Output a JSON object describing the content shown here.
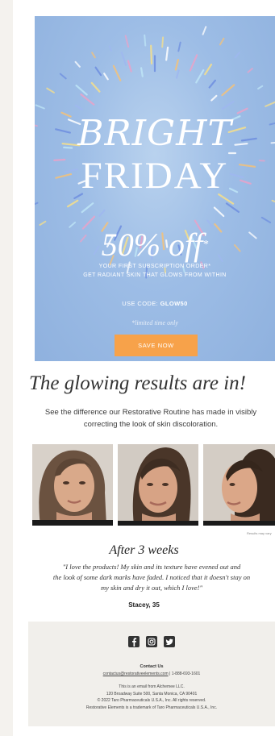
{
  "hero": {
    "headline_1": "BRIGHT",
    "headline_2": "FRIDAY",
    "discount": "50% off",
    "discount_note": "*",
    "subline_1": "YOUR FIRST SUBSCRIPTION ORDER*",
    "subline_2": "GET RADIANT SKIN THAT GLOWS FROM WITHIN",
    "code_label": "USE CODE:",
    "code": "GLOW50",
    "limited": "*limited time only",
    "cta_label": "SAVE NOW",
    "colors": {
      "background": "#9dbde6",
      "cta": "#f7a24a"
    }
  },
  "results": {
    "headline": "The glowing results are in!",
    "description_1": "See the difference our Restorative Routine has made in visibly",
    "description_2": "correcting the look of skin discoloration.",
    "photos": [
      {
        "alt": "face-front"
      },
      {
        "alt": "face-angle"
      },
      {
        "alt": "face-profile"
      }
    ],
    "disclaimer": "Results may vary",
    "after_title": "After 3 weeks",
    "quote_1": "\"I love the products! My skin and its texture have evened out and",
    "quote_2": "the look of some dark marks have faded. I noticed that it doesn't stay on",
    "quote_3": "my skin and dry it out, which I love!\"",
    "author": "Stacey, 35"
  },
  "footer": {
    "social_icons": [
      "facebook-icon",
      "instagram-icon",
      "twitter-icon"
    ],
    "contact_title": "Contact Us",
    "email": "contactus@restorativeelements.com",
    "separator": "|",
    "phone": "1-888-693-1601",
    "line_1": "This is an email from Alchemee LLC.",
    "line_2": "120 Broadway Suite 500, Santa Monica, CA 90401",
    "line_3": "© 2022 Taro Pharmaceuticals U.S.A., Inc. All rights reserved.",
    "line_4": "Restorative Elements is a trademark of Taro Pharmaceuticals U.S.A., Inc."
  }
}
